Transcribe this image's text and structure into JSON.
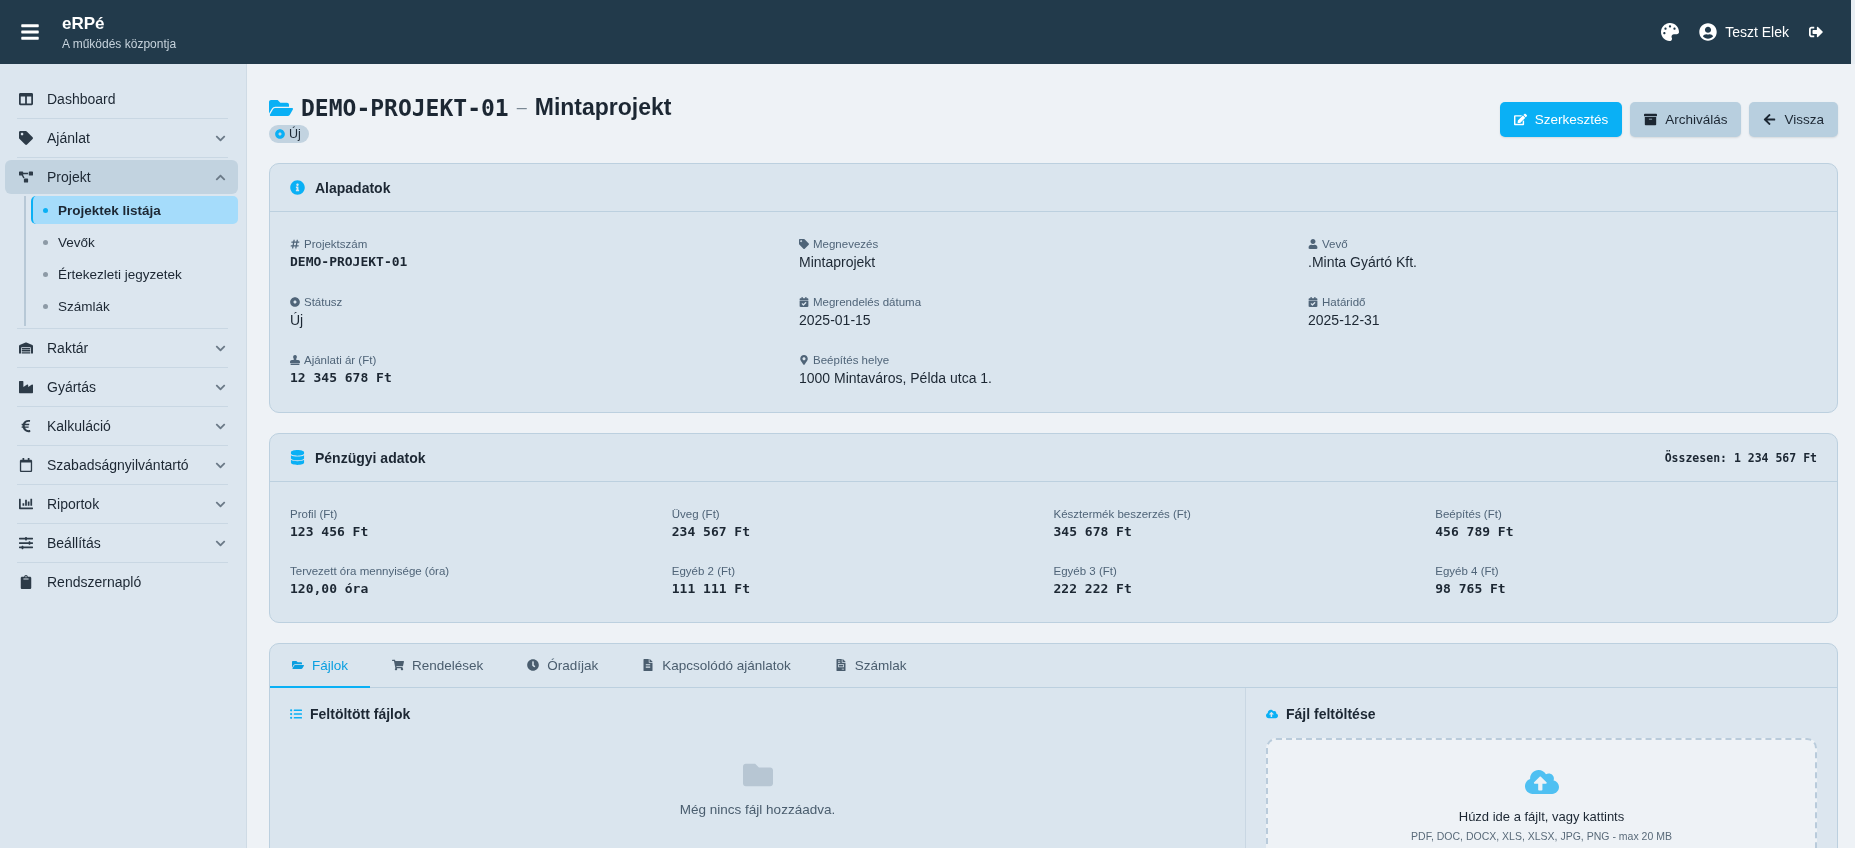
{
  "header": {
    "app_name": "eRPé",
    "tagline": "A működés központja",
    "user_name": "Teszt Elek"
  },
  "sidebar": {
    "items": [
      {
        "label": "Dashboard",
        "kind": "link"
      },
      {
        "label": "Ajánlat",
        "kind": "group",
        "expanded": false
      },
      {
        "label": "Projekt",
        "kind": "group",
        "expanded": true,
        "children": [
          {
            "label": "Projektek listája",
            "selected": true
          },
          {
            "label": "Vevők",
            "selected": false
          },
          {
            "label": "Értekezleti jegyzetek",
            "selected": false
          },
          {
            "label": "Számlák",
            "selected": false
          }
        ]
      },
      {
        "label": "Raktár",
        "kind": "group",
        "expanded": false
      },
      {
        "label": "Gyártás",
        "kind": "group",
        "expanded": false
      },
      {
        "label": "Kalkuláció",
        "kind": "group",
        "expanded": false
      },
      {
        "label": "Szabadságnyilvántartó",
        "kind": "group",
        "expanded": false
      },
      {
        "label": "Riportok",
        "kind": "group",
        "expanded": false
      },
      {
        "label": "Beállítás",
        "kind": "group",
        "expanded": false
      },
      {
        "label": "Rendszernapló",
        "kind": "link"
      }
    ]
  },
  "project": {
    "code": "DEMO-PROJEKT-01",
    "separator": "–",
    "name": "Mintaprojekt",
    "status": "Új"
  },
  "actions": [
    {
      "label": "Szerkesztés",
      "kind": "primary"
    },
    {
      "label": "Archiválás",
      "kind": "secondary"
    },
    {
      "label": "Vissza",
      "kind": "secondary"
    }
  ],
  "basic_card": {
    "title": "Alapadatok",
    "fields": [
      {
        "label": "Projektszám",
        "value": "DEMO-PROJEKT-01",
        "kind": "mono"
      },
      {
        "label": "Megnevezés",
        "value": "Mintaprojekt",
        "kind": "text"
      },
      {
        "label": "Vevő",
        "value": ".Minta Gyártó Kft.",
        "kind": "text"
      },
      {
        "label": "Státusz",
        "value": "Új",
        "kind": "text"
      },
      {
        "label": "Megrendelés dátuma",
        "value": "2025-01-15",
        "kind": "text"
      },
      {
        "label": "Határidő",
        "value": "2025-12-31",
        "kind": "text"
      },
      {
        "label": "Ajánlati ár (Ft)",
        "value": "12 345 678 Ft",
        "kind": "mono"
      },
      {
        "label": "Beépítés helye",
        "value": "1000 Mintaváros, Példa utca 1.",
        "kind": "text"
      }
    ]
  },
  "finance_card": {
    "title": "Pénzügyi adatok",
    "total": "Összesen: 1 234 567 Ft",
    "fields": [
      {
        "label": "Profil (Ft)",
        "value": "123 456 Ft"
      },
      {
        "label": "Üveg (Ft)",
        "value": "234 567 Ft"
      },
      {
        "label": "Késztermék beszerzés (Ft)",
        "value": "345 678 Ft"
      },
      {
        "label": "Beépítés (Ft)",
        "value": "456 789 Ft"
      },
      {
        "label": "Tervezett óra mennyisége (óra)",
        "value": "120,00 óra"
      },
      {
        "label": "Egyéb 2 (Ft)",
        "value": "111 111 Ft"
      },
      {
        "label": "Egyéb 3 (Ft)",
        "value": "222 222 Ft"
      },
      {
        "label": "Egyéb 4 (Ft)",
        "value": "98 765 Ft"
      }
    ]
  },
  "tabs": [
    {
      "label": "Fájlok",
      "selected": true
    },
    {
      "label": "Rendelések",
      "selected": false
    },
    {
      "label": "Óradíjak",
      "selected": false
    },
    {
      "label": "Kapcsolódó ajánlatok",
      "selected": false
    },
    {
      "label": "Számlak",
      "selected": false
    }
  ],
  "files_panel": {
    "title": "Feltöltött fájlok",
    "empty_message": "Még nincs fájl hozzáadva."
  },
  "upload_panel": {
    "title": "Fájl feltöltése",
    "hint": "Húzd ide a fájlt, vagy kattints",
    "formats": "PDF, DOC, DOCX, XLS, XLSX, JPG, PNG - max 20 MB"
  }
}
